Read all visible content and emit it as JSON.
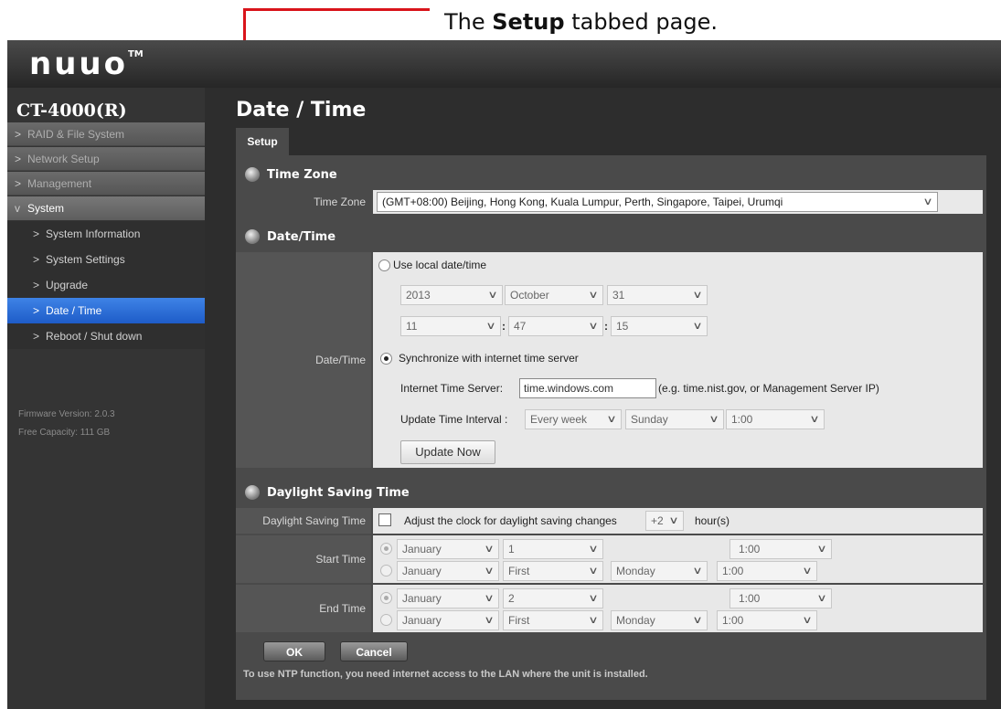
{
  "annotation": {
    "prefix": "The ",
    "bold": "Setup",
    "suffix": " tabbed page."
  },
  "app": {
    "logo": "nuuo",
    "logo_tm": "TM"
  },
  "sidebar": {
    "device_name": "CT-4000(R)",
    "top_items": [
      {
        "label": "RAID & File System",
        "chevron": ">"
      },
      {
        "label": "Network Setup",
        "chevron": ">"
      },
      {
        "label": "Management",
        "chevron": ">"
      },
      {
        "label": "System",
        "chevron": "v"
      }
    ],
    "sub_items": [
      {
        "label": "System Information"
      },
      {
        "label": "System Settings"
      },
      {
        "label": "Upgrade"
      },
      {
        "label": "Date / Time",
        "active": true
      },
      {
        "label": "Reboot / Shut down"
      }
    ],
    "sub_chevron": ">",
    "firmware": "Firmware Version: 2.0.3",
    "capacity": "Free Capacity: 111 GB"
  },
  "main": {
    "title": "Date / Time",
    "tab": "Setup",
    "timezone": {
      "section": "Time Zone",
      "label": "Time Zone",
      "value": "(GMT+08:00) Beijing, Hong Kong, Kuala Lumpur, Perth, Singapore, Taipei, Urumqi"
    },
    "datetime": {
      "section": "Date/Time",
      "label": "Date/Time",
      "use_local": "Use local date/time",
      "year": "2013",
      "month": "October",
      "day": "31",
      "hour": "11",
      "minute": "47",
      "second": "15",
      "colon": ":",
      "sync": "Synchronize with internet time server",
      "server_label": "Internet Time Server:",
      "server_value": "time.windows.com",
      "server_hint": "(e.g. time.nist.gov, or Management Server IP)",
      "interval_label": "Update Time Interval :",
      "interval": "Every week",
      "interval_day": "Sunday",
      "interval_time": "1:00",
      "update_now": "Update Now"
    },
    "dst": {
      "section": "Daylight Saving Time",
      "label": "Daylight Saving Time",
      "adjust": "Adjust the clock for daylight saving changes",
      "offset": "+2",
      "unit": "hour(s)",
      "start_label": "Start Time",
      "start": {
        "month1": "January",
        "day1": "1",
        "time1": "1:00",
        "month2": "January",
        "week2": "First",
        "weekday2": "Monday",
        "time2": "1:00"
      },
      "end_label": "End Time",
      "end": {
        "month1": "January",
        "day1": "2",
        "time1": "1:00",
        "month2": "January",
        "week2": "First",
        "weekday2": "Monday",
        "time2": "1:00"
      }
    },
    "ok": "OK",
    "cancel": "Cancel",
    "note": "To use NTP function, you need internet access to the LAN where the unit is installed."
  },
  "colors": {
    "accent_red": "#d9141b",
    "active_nav": "#2f6fd8",
    "panel": "#4a4a4a"
  }
}
